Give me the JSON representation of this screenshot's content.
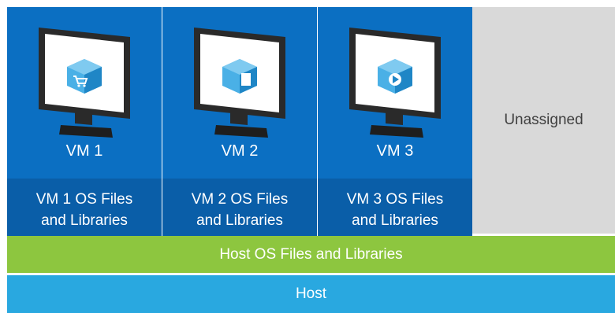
{
  "vms": [
    {
      "label": "VM 1",
      "files": "VM 1 OS Files\nand Libraries",
      "icon": "cart-icon"
    },
    {
      "label": "VM 2",
      "files": "VM 2 OS Files\nand Libraries",
      "icon": "document-icon"
    },
    {
      "label": "VM 3",
      "files": "VM 3 OS Files\nand Libraries",
      "icon": "play-icon"
    }
  ],
  "unassigned": "Unassigned",
  "host_os": "Host OS Files and Libraries",
  "host": "Host",
  "colors": {
    "vm_top": "#0b6fc2",
    "vm_files": "#0a5ea8",
    "unassigned": "#d9d9d9",
    "host_os": "#8dc63f",
    "host": "#29a8e0",
    "cube": "#4ab0e6"
  }
}
